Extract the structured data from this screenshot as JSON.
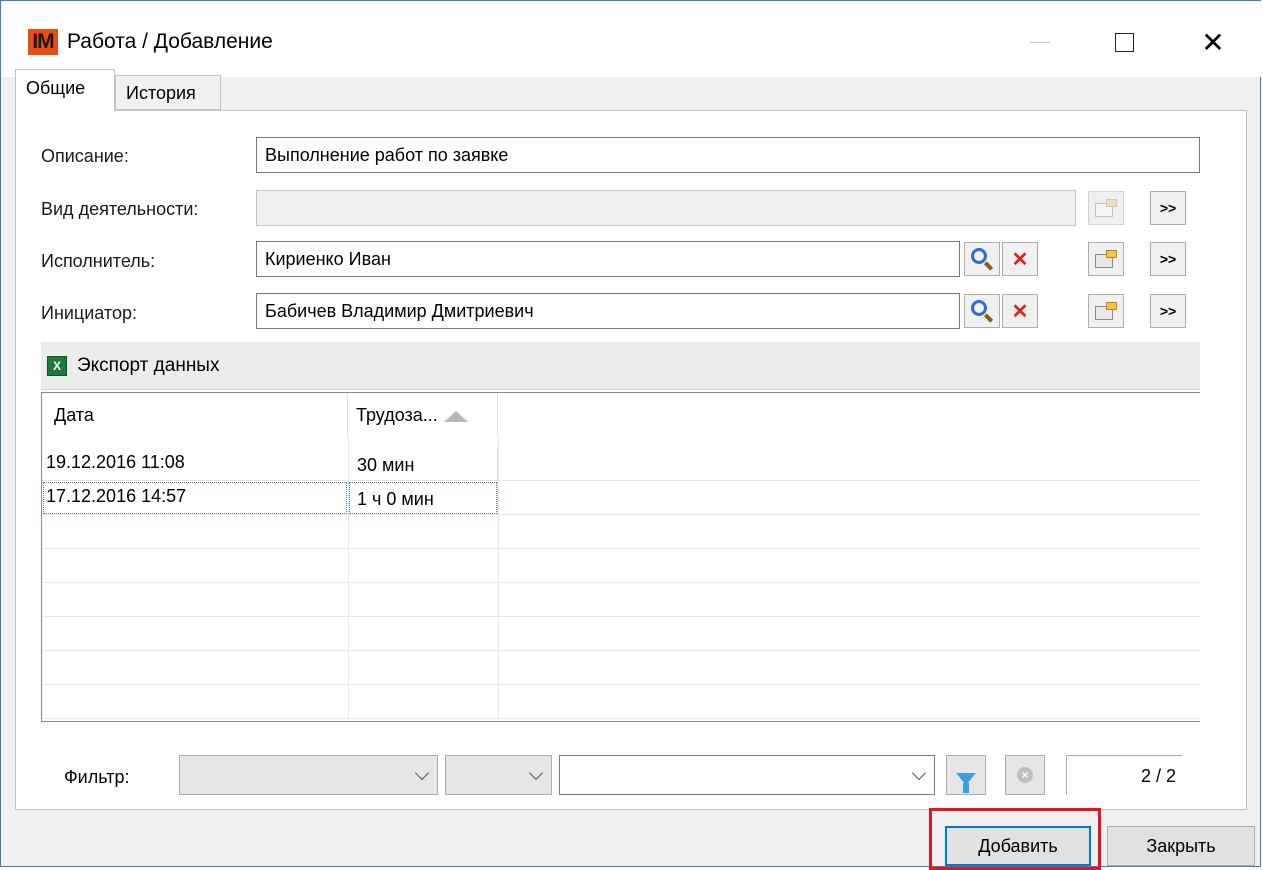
{
  "window": {
    "app_icon_text": "IM",
    "title": "Работа / Добавление",
    "controls": {
      "close_glyph": "✕"
    }
  },
  "tabs": [
    {
      "label": "Общие",
      "active": true
    },
    {
      "label": "История",
      "active": false
    }
  ],
  "form": {
    "description": {
      "label": "Описание:",
      "value": "Выполнение работ по заявке"
    },
    "activity_type": {
      "label": "Вид деятельности:",
      "value": ""
    },
    "executor": {
      "label": "Исполнитель:",
      "value": "Кириенко Иван"
    },
    "initiator": {
      "label": "Инициатор:",
      "value": "Бабичев Владимир Дмитриевич"
    },
    "more_label": ">>",
    "clear_glyph": "✕"
  },
  "toolbar": {
    "export_label": "Экспорт данных",
    "excel_icon_text": "X"
  },
  "grid": {
    "columns": [
      "Дата",
      "Трудоза..."
    ],
    "sort": {
      "column": "Трудоза...",
      "direction": "ascending"
    },
    "rows": [
      {
        "date": "19.12.2016 11:08",
        "work": "30 мин",
        "selected": false
      },
      {
        "date": "17.12.2016 14:57",
        "work": "1 ч 0 мин",
        "selected": true
      }
    ]
  },
  "filter": {
    "label": "Фильтр:",
    "field": "",
    "operator": "",
    "value": "",
    "clear_glyph": "×",
    "counter": "2 / 2"
  },
  "buttons": {
    "add": "Добавить",
    "close": "Закрыть"
  },
  "colors": {
    "highlight": "#e4151e",
    "default_button_border": "#0078d7",
    "app_icon": "#e84d12"
  }
}
